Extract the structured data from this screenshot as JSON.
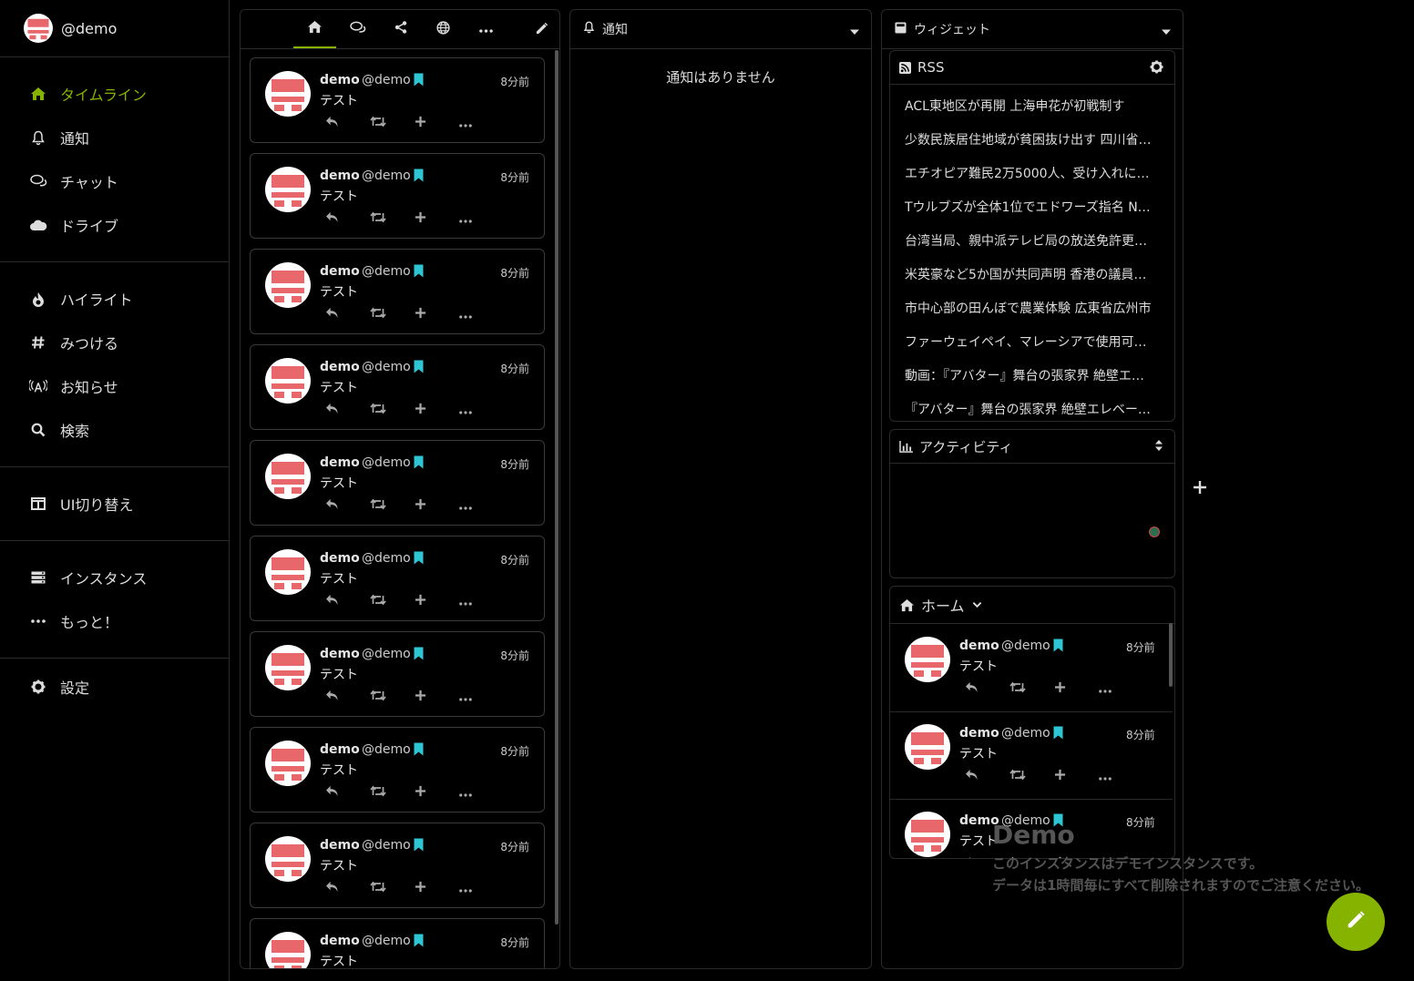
{
  "account": {
    "handle": "@demo"
  },
  "sidebar": {
    "groups": [
      [
        {
          "label": "タイムライン",
          "icon": "home-icon",
          "active": true
        },
        {
          "label": "通知",
          "icon": "bell-icon"
        },
        {
          "label": "チャット",
          "icon": "comments-icon"
        },
        {
          "label": "ドライブ",
          "icon": "cloud-icon"
        }
      ],
      [
        {
          "label": "ハイライト",
          "icon": "fire-icon"
        },
        {
          "label": "みつける",
          "icon": "hashtag-icon"
        },
        {
          "label": "お知らせ",
          "icon": "broadcast-icon"
        },
        {
          "label": "検索",
          "icon": "search-icon"
        }
      ],
      [
        {
          "label": "UI切り替え",
          "icon": "columns-icon"
        }
      ],
      [
        {
          "label": "インスタンス",
          "icon": "server-icon"
        },
        {
          "label": "もっと！",
          "icon": "ellipsis-icon"
        }
      ]
    ],
    "settings": "設定"
  },
  "timeline": {
    "tabs": [
      "home-icon",
      "comments-icon",
      "share-icon",
      "globe-icon",
      "ellipsis-icon"
    ],
    "active_tab": 0,
    "note": {
      "name": "demo",
      "acct": "@demo",
      "time": "8分前",
      "text": "テスト"
    }
  },
  "notifications": {
    "title": "通知",
    "empty": "通知はありません"
  },
  "widgets": {
    "title": "ウィジェット",
    "rss": {
      "title": "RSS",
      "items": [
        "ACL東地区が再開 上海申花が初戦制す",
        "少数民族居住地域が貧困抜け出す 四川省…",
        "エチオピア難民2万5000人、受け入れに…",
        "Tウルブズが全体1位でエドワーズ指名 N…",
        "台湾当局、親中派テレビ局の放送免許更…",
        "米英豪など5か国が共同声明 香港の議員…",
        "市中心部の田んぼで農業体験 広東省広州市",
        "ファーウェイペイ、マレーシアで使用可…",
        "動画：『アバター』舞台の張家界 絶壁エ…",
        "『アバター』舞台の張家界 絶壁エレベー…"
      ]
    },
    "activity": {
      "title": "アクティビティ"
    },
    "home": {
      "title": "ホーム"
    }
  },
  "demo_notice": {
    "title": "Demo",
    "line1": "このインスタンスはデモインスタンスです。",
    "line2": "データは1時間毎にすべて削除されますのでご注意ください。"
  },
  "colors": {
    "accent": "#86b300",
    "avatar": "#e8676b",
    "badge": "#2ec6d4"
  }
}
